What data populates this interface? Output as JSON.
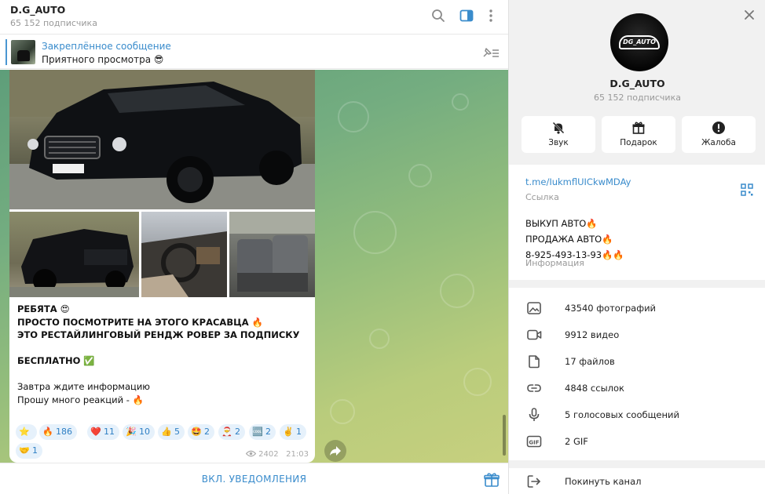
{
  "channel": {
    "title": "D.G_AUTO",
    "subscribers": "65 152 подписчика"
  },
  "pinned": {
    "title": "Закреплённое сообщение",
    "text": "Приятного просмотра 😎"
  },
  "post": {
    "line1": "РЕБЯТА 😍",
    "line2": "ПРОСТО ПОСМОТРИТЕ НА ЭТОГО КРАСАВЦА 🔥",
    "line3": "ЭТО РЕСТАЙЛИНГОВЫЙ РЕНДЖ РОВЕР ЗА ПОДПИСКУ",
    "line4": "БЕСПЛАТНО ✅",
    "line5": "Завтра ждите информацию",
    "line6": "Прошу много реакций - 🔥",
    "views": "2402",
    "time": "21:03",
    "reactions": [
      {
        "emoji": "⭐",
        "count": ""
      },
      {
        "emoji": "🔥",
        "count": "186"
      },
      {
        "emoji": "❤️",
        "count": "11"
      },
      {
        "emoji": "🎉",
        "count": "10"
      },
      {
        "emoji": "👍",
        "count": "5"
      },
      {
        "emoji": "🤩",
        "count": "2"
      },
      {
        "emoji": "🎅",
        "count": "2"
      },
      {
        "emoji": "🆒",
        "count": "2"
      },
      {
        "emoji": "✌️",
        "count": "1"
      },
      {
        "emoji": "🤝",
        "count": "1"
      }
    ]
  },
  "bottom": {
    "notify_label": "ВКЛ. УВЕДОМЛЕНИЯ"
  },
  "panel": {
    "avatar_text": "DG_AUTO",
    "actions": [
      {
        "label": "Звук",
        "icon": "mute-bell-icon"
      },
      {
        "label": "Подарок",
        "icon": "gift-icon"
      },
      {
        "label": "Жалоба",
        "icon": "report-icon"
      }
    ],
    "link": "t.me/IukmflUICkwMDAy",
    "link_caption": "Ссылка",
    "description": "ВЫКУП АВТО🔥\nПРОДАЖА АВТО🔥\n8-925-493-13-93🔥🔥",
    "description_caption": "Информация",
    "media": [
      {
        "label": "43540 фотографий",
        "icon": "photo-icon"
      },
      {
        "label": "9912 видео",
        "icon": "video-icon"
      },
      {
        "label": "17 файлов",
        "icon": "file-icon"
      },
      {
        "label": "4848 ссылок",
        "icon": "link-icon"
      },
      {
        "label": "5 голосовых сообщений",
        "icon": "microphone-icon"
      },
      {
        "label": "2 GIF",
        "icon": "gif-icon"
      }
    ],
    "leave_label": "Покинуть канал"
  },
  "colors": {
    "accent": "#3a8ccc",
    "reaction_bg": "#e6f1fb",
    "wallpaper_top": "#5e9e7a",
    "wallpaper_bottom": "#c7d07e"
  }
}
